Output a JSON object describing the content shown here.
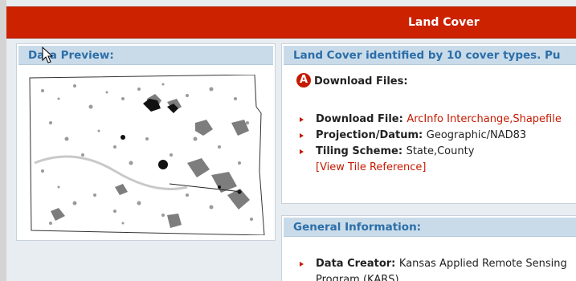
{
  "page": {
    "title": "Land Cover"
  },
  "preview": {
    "header": "Data Preview:"
  },
  "files": {
    "header": "Land Cover identified by 10 cover types. Pu",
    "badge": "A",
    "heading": "Download Files:",
    "download_label": "Download File:",
    "download_link": "ArcInfo Interchange,Shapefile",
    "projection_label": "Projection/Datum:",
    "projection_value": "Geographic/NAD83",
    "tiling_label": "Tiling Scheme:",
    "tiling_value": "State,County",
    "tile_reference_link": "[View Tile Reference]"
  },
  "general": {
    "header": "General Information:",
    "creator_label": "Data Creator:",
    "creator_value": "Kansas Applied Remote Sensing Program (KARS)"
  },
  "colors": {
    "title_bar": "#cc2200",
    "panel_header_bg": "#c9dbe9",
    "panel_header_text": "#2c6ea8",
    "link": "#c51a00"
  }
}
